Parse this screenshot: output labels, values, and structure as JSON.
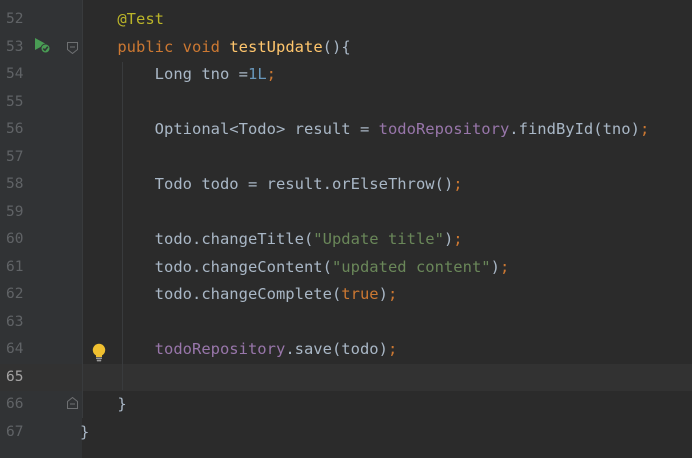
{
  "editor": {
    "current_line": "65",
    "lines": [
      {
        "num": "52",
        "tokens": [
          {
            "t": "    "
          },
          {
            "t": "@Test",
            "c": "ann"
          }
        ]
      },
      {
        "num": "53",
        "tokens": [
          {
            "t": "    "
          },
          {
            "t": "public",
            "c": "kw"
          },
          {
            "t": " "
          },
          {
            "t": "void",
            "c": "kw"
          },
          {
            "t": " "
          },
          {
            "t": "testUpdate",
            "c": "fn"
          },
          {
            "t": "(){"
          }
        ]
      },
      {
        "num": "54",
        "tokens": [
          {
            "t": "        Long tno ="
          },
          {
            "t": "1L",
            "c": "num"
          },
          {
            "t": ";",
            "c": "sep"
          }
        ]
      },
      {
        "num": "55",
        "tokens": []
      },
      {
        "num": "56",
        "tokens": [
          {
            "t": "        Optional<Todo> result = "
          },
          {
            "t": "todoRepository",
            "c": "fld"
          },
          {
            "t": ".findById(tno)"
          },
          {
            "t": ";",
            "c": "sep"
          }
        ]
      },
      {
        "num": "57",
        "tokens": []
      },
      {
        "num": "58",
        "tokens": [
          {
            "t": "        Todo todo = result.orElseThrow()"
          },
          {
            "t": ";",
            "c": "sep"
          }
        ]
      },
      {
        "num": "59",
        "tokens": []
      },
      {
        "num": "60",
        "tokens": [
          {
            "t": "        todo.changeTitle("
          },
          {
            "t": "\"Update title\"",
            "c": "str"
          },
          {
            "t": ")"
          },
          {
            "t": ";",
            "c": "sep"
          }
        ]
      },
      {
        "num": "61",
        "tokens": [
          {
            "t": "        todo.changeContent("
          },
          {
            "t": "\"updated content\"",
            "c": "str"
          },
          {
            "t": ")"
          },
          {
            "t": ";",
            "c": "sep"
          }
        ]
      },
      {
        "num": "62",
        "tokens": [
          {
            "t": "        todo.changeComplete("
          },
          {
            "t": "true",
            "c": "kw"
          },
          {
            "t": ")"
          },
          {
            "t": ";",
            "c": "sep"
          }
        ]
      },
      {
        "num": "63",
        "tokens": []
      },
      {
        "num": "64",
        "tokens": [
          {
            "t": "        "
          },
          {
            "t": "todoRepository",
            "c": "fld"
          },
          {
            "t": ".save(todo)"
          },
          {
            "t": ";",
            "c": "sep"
          }
        ]
      },
      {
        "num": "65",
        "tokens": []
      },
      {
        "num": "66",
        "tokens": [
          {
            "t": "    }"
          }
        ]
      },
      {
        "num": "67",
        "tokens": [
          {
            "t": "}"
          }
        ]
      },
      {
        "num": "",
        "tokens": []
      }
    ]
  },
  "icons": {
    "run_gutter": "run-test-icon",
    "fold_open": "fold-open-icon",
    "fold_close": "fold-close-icon",
    "intention": "lightbulb-icon"
  },
  "colors": {
    "background": "#2b2b2b",
    "gutter": "#313335",
    "keyword": "#cc7832",
    "annotation": "#bbb529",
    "method": "#ffc66d",
    "string": "#6a8759",
    "number": "#6897bb",
    "field": "#9876aa",
    "text": "#a9b7c6",
    "run_icon": "#499c54",
    "bulb": "#f0c030"
  }
}
